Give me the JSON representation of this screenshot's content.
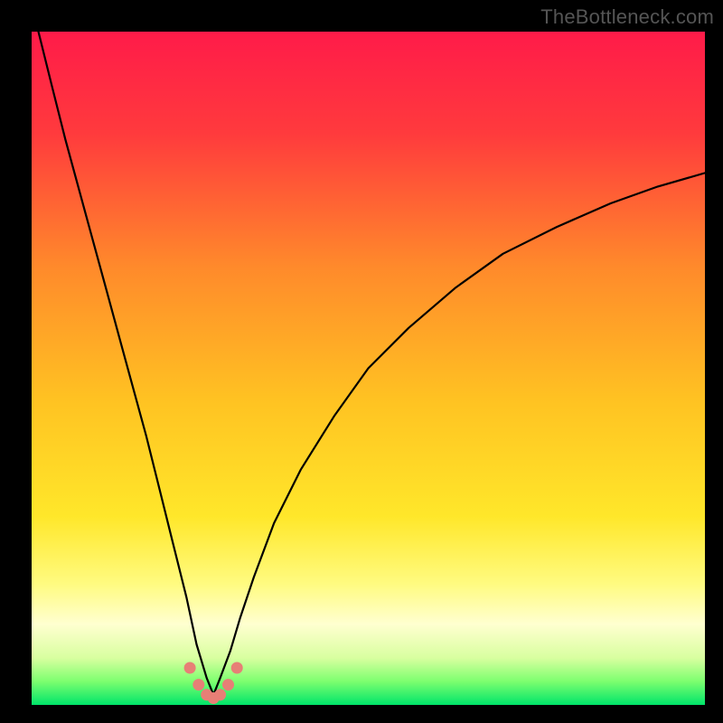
{
  "watermark": "TheBottleneck.com",
  "colors": {
    "frame": "#000000",
    "gradient_stops": [
      {
        "offset": 0.0,
        "color": "#ff1b49"
      },
      {
        "offset": 0.15,
        "color": "#ff3a3d"
      },
      {
        "offset": 0.35,
        "color": "#ff8a2b"
      },
      {
        "offset": 0.55,
        "color": "#ffc322"
      },
      {
        "offset": 0.72,
        "color": "#ffe72a"
      },
      {
        "offset": 0.82,
        "color": "#fffb80"
      },
      {
        "offset": 0.88,
        "color": "#ffffd0"
      },
      {
        "offset": 0.93,
        "color": "#d9ffa0"
      },
      {
        "offset": 0.965,
        "color": "#7dff6f"
      },
      {
        "offset": 1.0,
        "color": "#00e46a"
      }
    ],
    "curve": "#000000",
    "marker": "#e77f76"
  },
  "chart_data": {
    "type": "line",
    "title": "",
    "xlabel": "",
    "ylabel": "",
    "xlim": [
      0,
      100
    ],
    "ylim": [
      0,
      100
    ],
    "note": "Bottleneck-style V curve. y ≈ 100 at x→0, reaches 0 near x≈27, rises toward ~79 at x=100. Values read from pixel positions (approximate).",
    "series": [
      {
        "name": "curve",
        "x": [
          1,
          3,
          5,
          8,
          11,
          14,
          17,
          19,
          21,
          23,
          24.5,
          26,
          27,
          28,
          29.5,
          31,
          33,
          36,
          40,
          45,
          50,
          56,
          63,
          70,
          78,
          86,
          93,
          100
        ],
        "y": [
          100,
          92,
          84,
          73,
          62,
          51,
          40,
          32,
          24,
          16,
          9,
          4,
          1.5,
          4,
          8,
          13,
          19,
          27,
          35,
          43,
          50,
          56,
          62,
          67,
          71,
          74.5,
          77,
          79
        ]
      }
    ],
    "markers": {
      "name": "highlight-dots",
      "x": [
        23.5,
        24.8,
        26.0,
        27.0,
        28.0,
        29.2,
        30.5
      ],
      "y": [
        5.5,
        3.0,
        1.5,
        1.0,
        1.5,
        3.0,
        5.5
      ]
    }
  }
}
